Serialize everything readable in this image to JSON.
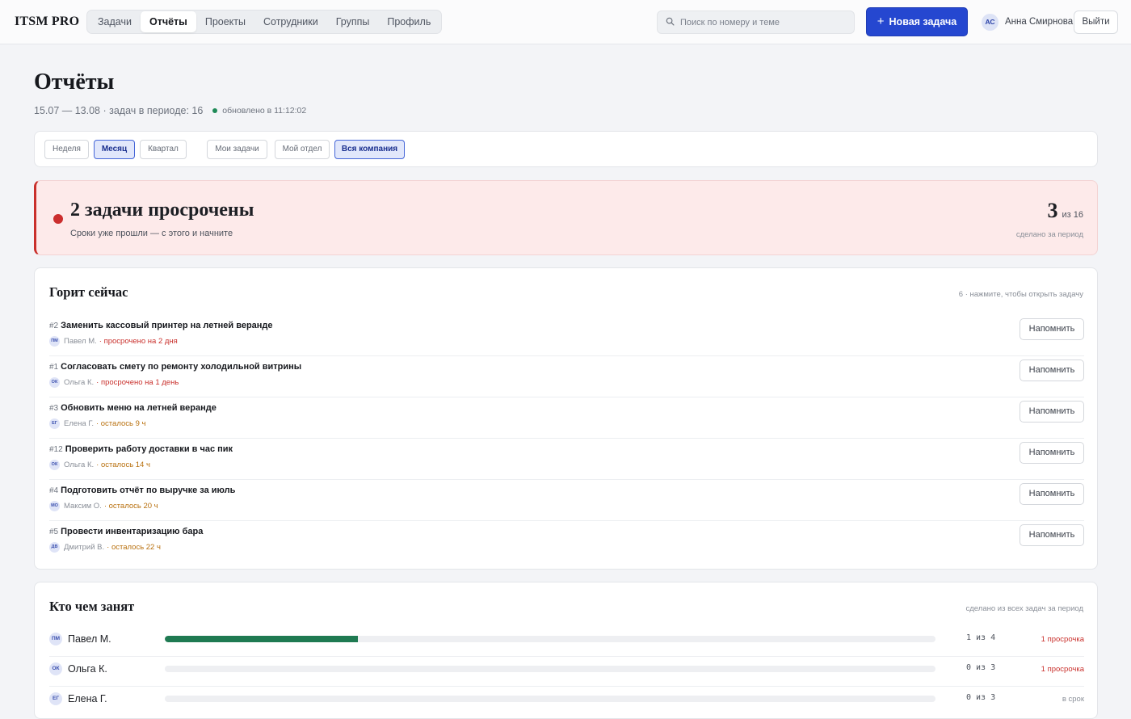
{
  "app": {
    "brand": "ITSM PRO",
    "nav": [
      "Задачи",
      "Отчёты",
      "Проекты",
      "Сотрудники",
      "Группы",
      "Профиль"
    ],
    "active_nav": "Отчёты",
    "search_placeholder": "Поиск по номеру и теме",
    "new_task_label": "Новая задача",
    "user": {
      "initials": "АС",
      "name": "Анна Смирнова"
    },
    "logout_label": "Выйти"
  },
  "page": {
    "title": "Отчёты",
    "period_text": "15.07 — 13.08 · задач в периоде: 16",
    "updated_text": "обновлено в 11:12:02"
  },
  "filters": {
    "period": [
      {
        "label": "Неделя",
        "active": false
      },
      {
        "label": "Месяц",
        "active": true
      },
      {
        "label": "Квартал",
        "active": false
      }
    ],
    "scope": [
      {
        "label": "Мои задачи",
        "active": false
      },
      {
        "label": "Мой отдел",
        "active": false
      },
      {
        "label": "Вся компания",
        "active": true
      }
    ]
  },
  "alert": {
    "title": "2 задачи просрочены",
    "subtitle": "Сроки уже прошли — с этого и начните",
    "done": "3",
    "total": "из 16",
    "done_label": "сделано за период",
    "colors": {
      "accent": "#c9302c",
      "background": "#fdeaea"
    }
  },
  "hot": {
    "title": "Горит сейчас",
    "hint": "6 · нажмите, чтобы открыть задачу",
    "remind_label": "Напомнить",
    "tasks": [
      {
        "num": "#2",
        "title": "Заменить кассовый принтер на летней веранде",
        "initials": "ПМ",
        "assignee": "Павел М.",
        "status": "· просрочено на 2 дня",
        "state": "overdue"
      },
      {
        "num": "#1",
        "title": "Согласовать смету по ремонту холодильной витрины",
        "initials": "ОК",
        "assignee": "Ольга К.",
        "status": "· просрочено на 1 день",
        "state": "overdue"
      },
      {
        "num": "#3",
        "title": "Обновить меню на летней веранде",
        "initials": "ЕГ",
        "assignee": "Елена Г.",
        "status": "· осталось 9 ч",
        "state": "remaining"
      },
      {
        "num": "#12",
        "title": "Проверить работу доставки в час пик",
        "initials": "ОК",
        "assignee": "Ольга К.",
        "status": "· осталось 14 ч",
        "state": "remaining"
      },
      {
        "num": "#4",
        "title": "Подготовить отчёт по выручке за июль",
        "initials": "МО",
        "assignee": "Максим О.",
        "status": "· осталось 20 ч",
        "state": "remaining"
      },
      {
        "num": "#5",
        "title": "Провести инвентаризацию бара",
        "initials": "ДВ",
        "assignee": "Дмитрий В.",
        "status": "· осталось 22 ч",
        "state": "remaining"
      }
    ]
  },
  "workload": {
    "title": "Кто чем занят",
    "hint": "сделано из всех задач за период",
    "people": [
      {
        "initials": "ПМ",
        "name": "Павел М.",
        "done": 1,
        "total": 4,
        "count_text": "1 из 4",
        "status": "1 просрочка",
        "state": "bad"
      },
      {
        "initials": "ОК",
        "name": "Ольга К.",
        "done": 0,
        "total": 3,
        "count_text": "0 из 3",
        "status": "1 просрочка",
        "state": "bad"
      },
      {
        "initials": "ЕГ",
        "name": "Елена Г.",
        "done": 0,
        "total": 3,
        "count_text": "0 из 3",
        "status": "в срок",
        "state": "ok"
      }
    ],
    "bar_color": "#1f7a52"
  }
}
